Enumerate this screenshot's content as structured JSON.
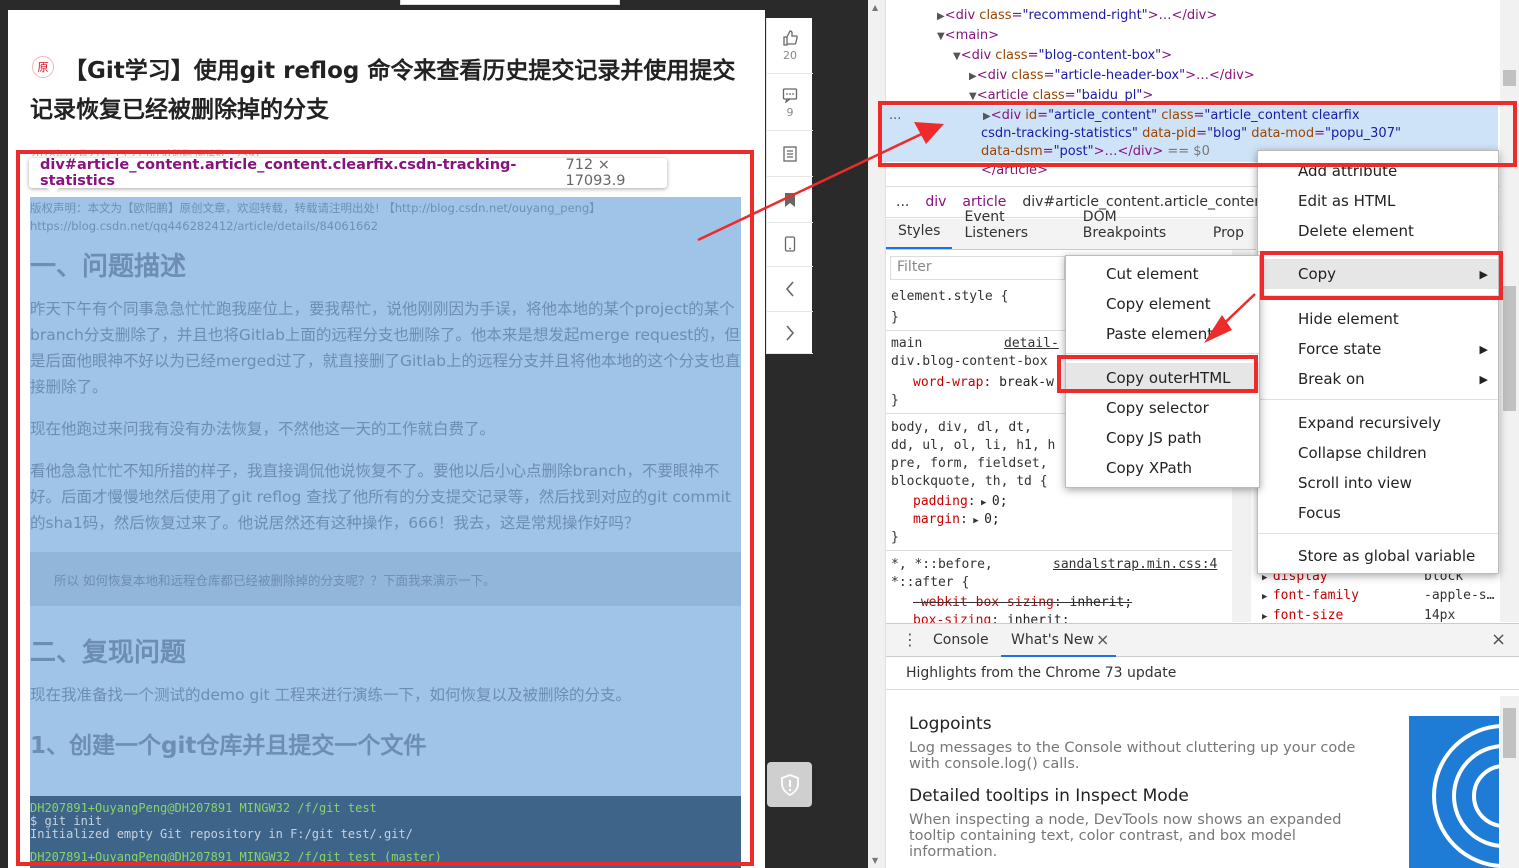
{
  "article": {
    "badge": "原",
    "title": "【Git学习】使用git reflog 命令来查看历史提交记录并使用提交记录恢复已经被删除掉的分支",
    "meta": "2018年02月21日 15:27:00   欧阳鹏   阅读数：2391",
    "copyright": "版权声明：本文为【欧阳鹏】原创文章，欢迎转载，转载请注明出处! 【http://blog.csdn.net/ouyang_peng】 https://blog.csdn.net/qq446282412/article/details/84061662",
    "h_problem": "一、问题描述",
    "p1": "昨天下午有个同事急急忙忙跑我座位上，要我帮忙，说他刚刚因为手误，将他本地的某个project的某个branch分支删除了，并且也将Gitlab上面的远程分支也删除了。他本来是想发起merge request的，但是后面他眼神不好以为已经merged过了，就直接删了Gitlab上的远程分支并且将他本地的这个分支也直接删除了。",
    "p2": "现在他跑过来问我有没有办法恢复，不然他这一天的工作就白费了。",
    "p3": "看他急急忙忙不知所措的样子，我直接调侃他说恢复不了。要他以后小心点删除branch，不要眼神不好。后面才慢慢地然后使用了git reflog 查找了他所有的分支提交记录等，然后找到对应的git commit的sha1码，然后恢复过来了。他说居然还有这种操作，666！我去，这是常规操作好吗？",
    "quote": "所以 如何恢复本地和远程仓库都已经被删除掉的分支呢？？下面我来演示一下。",
    "h_reproduce": "二、复现问题",
    "p4": "现在我准备找一个测试的demo git 工程来进行演练一下，如何恢复以及被删除的分支。",
    "h_step1": "1、创建一个git仓库并且提交一个文件",
    "code": [
      "DH207891+OuyangPeng@DH207891 MINGW32 /f/git test",
      "$ git init",
      "Initialized empty Git repository in F:/git test/.git/",
      "DH207891+OuyangPeng@DH207891 MINGW32 /f/git test (master)"
    ]
  },
  "tooltip": {
    "selector": "div#article_content.article_content.clearfix.csdn-tracking-statistics",
    "dims": "712 × 17093.9"
  },
  "toolbar": {
    "like_count": "20",
    "comment_count": "9",
    "icons": [
      "thumbs-up-icon",
      "comment-icon",
      "list-icon",
      "bookmark-icon",
      "phone-icon",
      "chevron-left-icon",
      "chevron-right-icon",
      "shield-icon"
    ]
  },
  "elements": {
    "line1": {
      "pre": "<div ",
      "attr": "class",
      "val": "\"recommend-right\"",
      "post": ">…</div>"
    },
    "line2": "<main>",
    "line3": {
      "attr": "class",
      "val": "\"blog-content-box\""
    },
    "line4": {
      "attr": "class",
      "val": "\"article-header-box\"",
      "post": ">…</div>"
    },
    "line5": {
      "attr": "class",
      "val": "\"baidu_pl\""
    },
    "sel1": {
      "id_val": "\"article_content\"",
      "class_val": "\"article_content clearfix"
    },
    "sel2": {
      "class_cont": "csdn-tracking-statistics\"",
      "pid_attr": "data-pid",
      "pid_val": "\"blog\"",
      "mod_attr": "data-mod",
      "mod_val": "\"popu_307\""
    },
    "sel3": {
      "dsm_attr": "data-dsm",
      "dsm_val": "\"post\"",
      "post": ">…</div>",
      "eq": "== $0"
    },
    "line9": "</article>",
    "dots": "..."
  },
  "breadcrumb": [
    "...",
    "div",
    "article",
    "div#article_content.article_content.c"
  ],
  "tabs": [
    "Styles",
    "Event Listeners",
    "DOM Breakpoints",
    "Prop"
  ],
  "filter_placeholder": "Filter",
  "styles": {
    "element_style": "element.style {",
    "close": "}",
    "main_sel": "main",
    "main_src": "detail-",
    "blog_sel": "div.blog-content-box",
    "wordwrap_prop": "word-wrap",
    "wordwrap_val": "break-w",
    "reset_sel1": "body, div, dl, dt,",
    "reset_sel2": "dd, ul, ol, li, h1, h",
    "reset_sel3": "pre, form, fieldset,",
    "reset_sel4": "blockquote, th, td {",
    "padding_prop": "padding",
    "padding_val": "0;",
    "margin_prop": "margin",
    "margin_val": "0;",
    "star_sel": "*, *::before,",
    "star_src": "sandalstrap.min.css:4",
    "star_sel2": "*::after {",
    "wbs_prop": "-webkit-box-sizing",
    "wbs_val": "inherit;",
    "bs_prop": "box-sizing",
    "bs_val": "inherit;"
  },
  "computed": [
    {
      "prop": "display",
      "val": "block"
    },
    {
      "prop": "font-family",
      "val": "-apple-s…"
    },
    {
      "prop": "font-size",
      "val": "14px"
    }
  ],
  "drawer": {
    "tabs": [
      "Console",
      "What's New"
    ],
    "close_tab": "×",
    "close": "×",
    "header": "Highlights from the Chrome 73 update",
    "items": [
      {
        "title": "Logpoints",
        "desc": "Log messages to the Console without cluttering up your code with console.log() calls."
      },
      {
        "title": "Detailed tooltips in Inspect Mode",
        "desc": "When inspecting a node, DevTools now shows an expanded tooltip containing text, color contrast, and box model information."
      }
    ]
  },
  "menu_main": {
    "items": [
      "Add attribute",
      "Edit as HTML",
      "Delete element",
      "Copy",
      "Hide element",
      "Force state",
      "Break on",
      "Expand recursively",
      "Collapse children",
      "Scroll into view",
      "Focus",
      "Store as global variable"
    ]
  },
  "menu_copy": {
    "items": [
      "Cut element",
      "Copy element",
      "Paste element",
      "Copy outerHTML",
      "Copy selector",
      "Copy JS path",
      "Copy XPath"
    ]
  },
  "colors": {
    "annotation_red": "#ee2b2b",
    "highlight_blue": "#9fc4e8",
    "selected_row": "#cfe3f8"
  }
}
